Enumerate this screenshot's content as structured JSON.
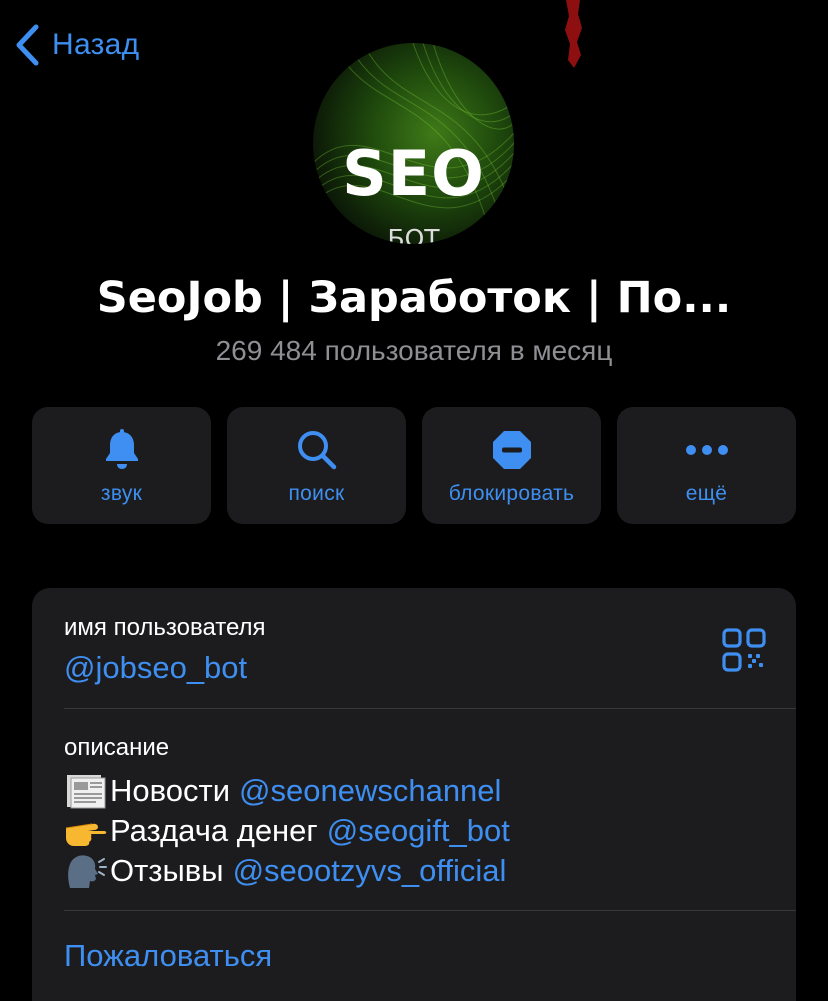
{
  "nav": {
    "back_label": "Назад"
  },
  "profile": {
    "avatar_title": "SEO",
    "avatar_subtitle": "БОТ",
    "name": "SeoJob | Заработок | По...",
    "subtitle": "269 484 пользователя в месяц"
  },
  "actions": [
    {
      "label": "звук",
      "icon": "bell-icon"
    },
    {
      "label": "поиск",
      "icon": "search-icon"
    },
    {
      "label": "блокировать",
      "icon": "block-icon"
    },
    {
      "label": "ещё",
      "icon": "more-icon"
    }
  ],
  "info": {
    "username_label": "имя пользователя",
    "username": "@jobseo_bot",
    "description_label": "описание",
    "description_lines": [
      {
        "emoji": "newspaper-emoji",
        "text": "Новости",
        "link": "@seonewschannel"
      },
      {
        "emoji": "pointing-hand-emoji",
        "text": "Раздача денег",
        "link": "@seogift_bot"
      },
      {
        "emoji": "speaking-head-emoji",
        "text": "Отзывы",
        "link": "@seootzyvs_official"
      }
    ],
    "report_label": "Пожаловаться"
  },
  "colors": {
    "background": "#000000",
    "card": "#1c1c1e",
    "accent": "#3e8ff1",
    "secondary_text": "#8e8e93",
    "separator": "#38383a"
  }
}
